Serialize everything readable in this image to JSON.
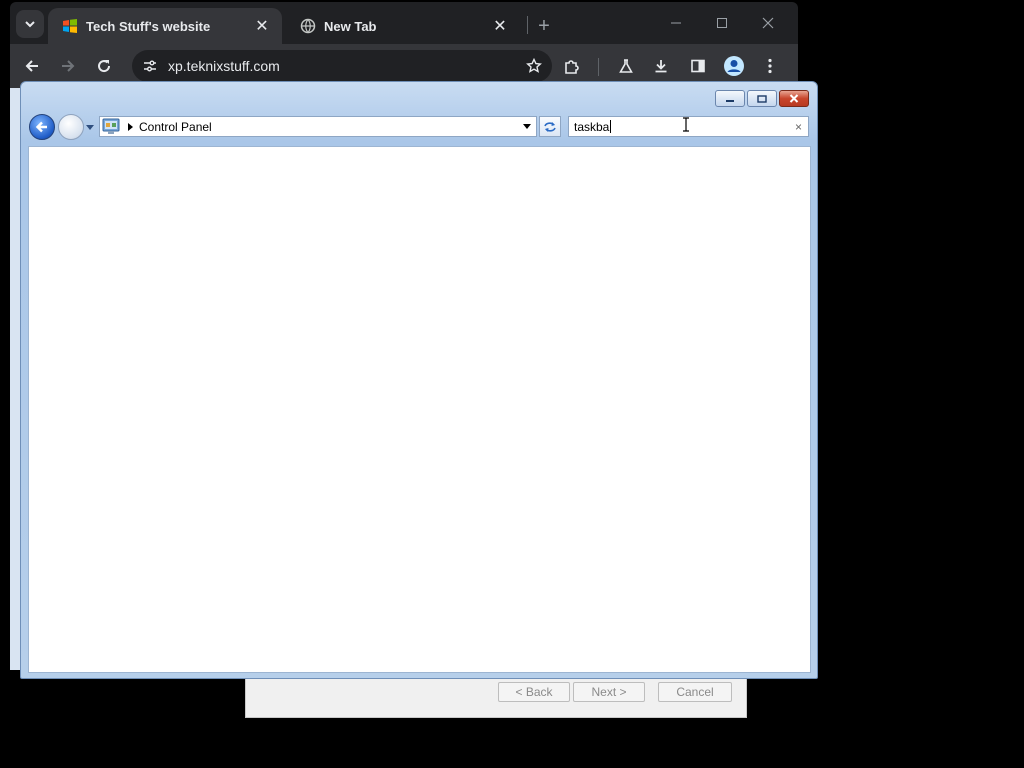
{
  "browser": {
    "tabs": [
      {
        "title": "Tech Stuff's website",
        "favicon": "windows-logo-icon",
        "active": true
      },
      {
        "title": "New Tab",
        "favicon": "globe-icon",
        "active": false
      }
    ],
    "new_tab": "+",
    "url": "xp.teknixstuff.com",
    "page_strip_color": "#d9e4f2"
  },
  "explorer": {
    "address": "Control Panel",
    "search_value": "taskba",
    "search_clear": "×"
  },
  "wizard": {
    "back_label": "< Back",
    "next_label": "Next >",
    "cancel_label": "Cancel"
  },
  "colors": {
    "chrome_frame": "#202124",
    "chrome_toolbar": "#35363a",
    "explorer_frame": "#a9c6e8",
    "close_button": "#c8452c"
  }
}
